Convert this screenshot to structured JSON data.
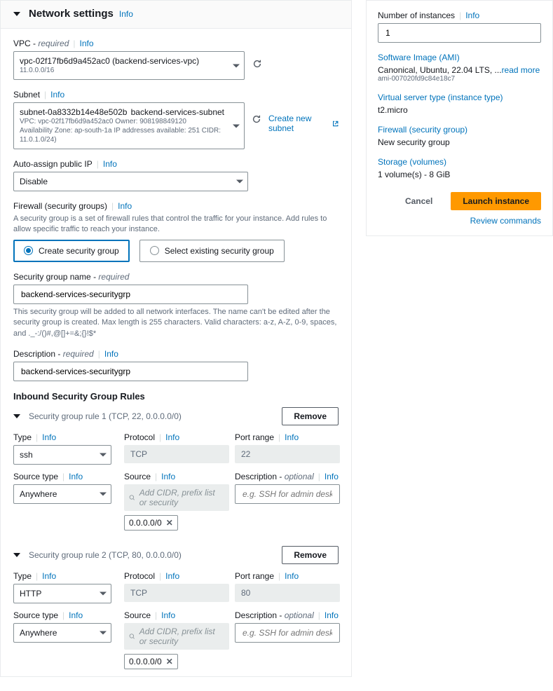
{
  "panel": {
    "title": "Network settings",
    "info": "Info"
  },
  "vpc": {
    "label": "VPC",
    "required": "required",
    "info": "Info",
    "value": "vpc-02f17fb6d9a452ac0 (backend-services-vpc)",
    "cidr": "11.0.0.0/16"
  },
  "subnet": {
    "label": "Subnet",
    "info": "Info",
    "value": "subnet-0a8332b14e48e502b",
    "name": "backend-services-subnet",
    "line1": "VPC: vpc-02f17fb6d9a452ac0    Owner: 908198849120",
    "line2": "Availability Zone: ap-south-1a    IP addresses available: 251    CIDR: 11.0.1.0/24)",
    "create_link": "Create new subnet"
  },
  "autoip": {
    "label": "Auto-assign public IP",
    "info": "Info",
    "value": "Disable"
  },
  "firewall": {
    "label": "Firewall (security groups)",
    "info": "Info",
    "help": "A security group is a set of firewall rules that control the traffic for your instance. Add rules to allow specific traffic to reach your instance.",
    "create": "Create security group",
    "select": "Select existing security group"
  },
  "sgname": {
    "label": "Security group name",
    "required": "required",
    "value": "backend-services-securitygrp",
    "help": "This security group will be added to all network interfaces. The name can't be edited after the security group is created. Max length is 255 characters. Valid characters: a-z, A-Z, 0-9, spaces, and ._-:/()#,@[]+=&;{}!$*"
  },
  "sgdesc": {
    "label": "Description",
    "required": "required",
    "info": "Info",
    "value": "backend-services-securitygrp"
  },
  "rules_title": "Inbound Security Group Rules",
  "common": {
    "type": "Type",
    "protocol": "Protocol",
    "port": "Port range",
    "source_type": "Source type",
    "source": "Source",
    "desc": "Description",
    "optional": "optional",
    "info": "Info",
    "remove": "Remove",
    "source_placeholder": "Add CIDR, prefix list or security",
    "desc_placeholder": "e.g. SSH for admin desktop"
  },
  "rule1": {
    "title": "Security group rule 1 (TCP, 22, 0.0.0.0/0)",
    "type": "ssh",
    "protocol": "TCP",
    "port": "22",
    "source_type": "Anywhere",
    "cidr": "0.0.0.0/0"
  },
  "rule2": {
    "title": "Security group rule 2 (TCP, 80, 0.0.0.0/0)",
    "type": "HTTP",
    "protocol": "TCP",
    "port": "80",
    "source_type": "Anywhere",
    "cidr": "0.0.0.0/0"
  },
  "summary": {
    "num_label": "Number of instances",
    "num_value": "1",
    "ami_label": "Software Image (AMI)",
    "ami_value": "Canonical, Ubuntu, 22.04 LTS, ...",
    "ami_read": "read more",
    "ami_id": "ami-007020fd9c84e18c7",
    "type_label": "Virtual server type (instance type)",
    "type_value": "t2.micro",
    "fw_label": "Firewall (security group)",
    "fw_value": "New security group",
    "storage_label": "Storage (volumes)",
    "storage_value": "1 volume(s) - 8 GiB",
    "cancel": "Cancel",
    "launch": "Launch instance",
    "review": "Review commands",
    "info": "Info"
  }
}
